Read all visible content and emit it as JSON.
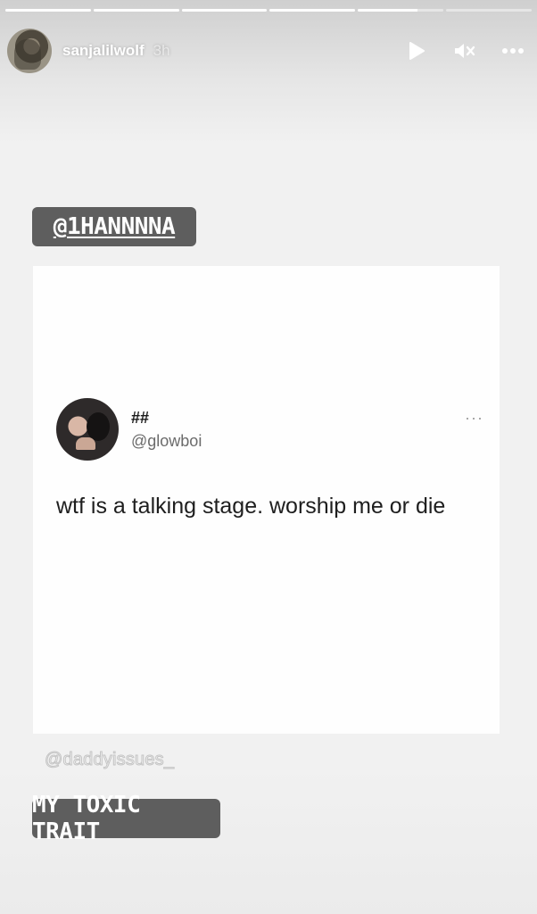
{
  "story": {
    "progress": [
      1,
      1,
      1,
      1,
      0.7,
      0
    ],
    "username": "sanjalilwolf",
    "time_ago": "3h",
    "actions": {
      "play": "play-icon",
      "mute": "mute-icon",
      "more": "more-icon"
    }
  },
  "stickers": {
    "mention": "@1HANNNNA",
    "caption": "MY TOXIC TRAIT"
  },
  "tweet": {
    "display_name": "##",
    "handle": "@glowboi",
    "more": "···",
    "text": "wtf is a talking stage. worship me or die"
  },
  "credit": "@daddyissues_",
  "colors": {
    "sticker_bg": "#5e5e5e",
    "card_bg": "#fefefe",
    "background": "#f1f1f1"
  }
}
